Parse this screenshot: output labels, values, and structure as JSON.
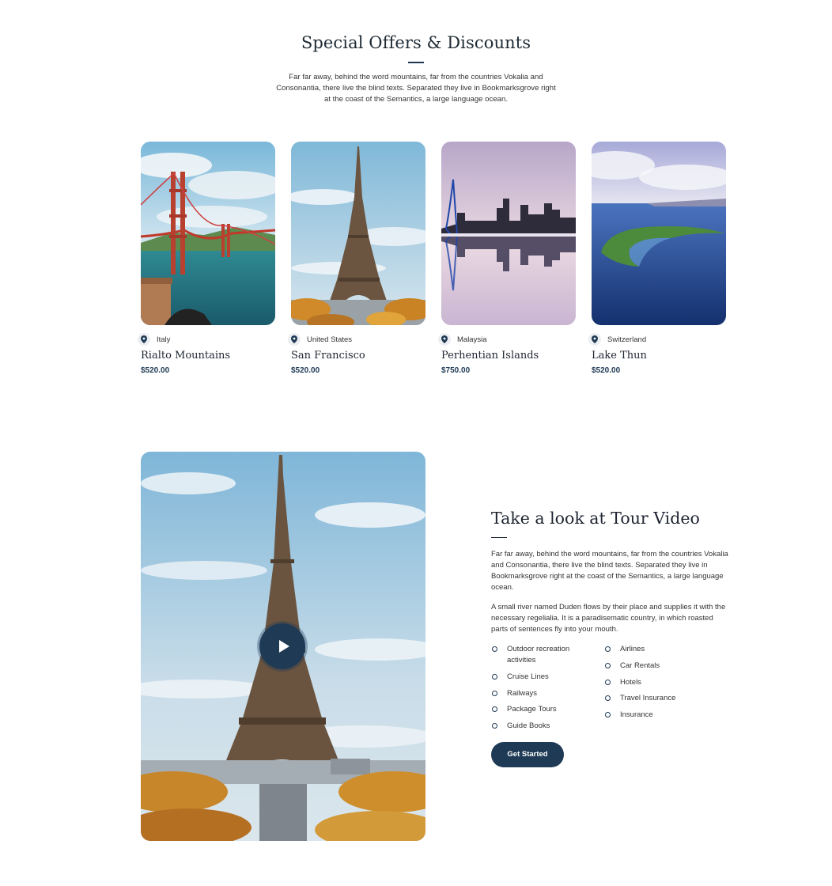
{
  "offers": {
    "title": "Special Offers & Discounts",
    "description": "Far far away, behind the word mountains, far from the countries Vokalia and Consonantia, there live the blind texts. Separated they live in Bookmarksgrove right at the coast of the Semantics, a large language ocean.",
    "cards": [
      {
        "country": "Italy",
        "name": "Rialto Mountains",
        "price": "$520.00",
        "image": "golden-gate-bridge-photo"
      },
      {
        "country": "United States",
        "name": "San Francisco",
        "price": "$520.00",
        "image": "eiffel-tower-photo"
      },
      {
        "country": "Malaysia",
        "name": "Perhentian Islands",
        "price": "$750.00",
        "image": "city-reflection-photo"
      },
      {
        "country": "Switzerland",
        "name": "Lake Thun",
        "price": "$520.00",
        "image": "island-lagoon-photo"
      }
    ]
  },
  "tour": {
    "title": "Take a look at Tour Video",
    "paragraph1": "Far far away, behind the word mountains, far from the countries Vokalia and Consonantia, there live the blind texts. Separated they live in Bookmarksgrove right at the coast of the Semantics, a large language ocean.",
    "paragraph2": "A small river named Duden flows by their place and supplies it with the necessary regelialia. It is a paradisematic country, in which roasted parts of sentences fly into your mouth.",
    "features_left": [
      "Outdoor recreation activities",
      "Cruise Lines",
      "Railways",
      "Package Tours",
      "Guide Books"
    ],
    "features_right": [
      "Airlines",
      "Car Rentals",
      "Hotels",
      "Travel Insurance",
      "Insurance"
    ],
    "cta_label": "Get Started",
    "video_image": "eiffel-tower-video-photo"
  },
  "colors": {
    "accent": "#1f3a55",
    "heading": "#1e2430"
  }
}
